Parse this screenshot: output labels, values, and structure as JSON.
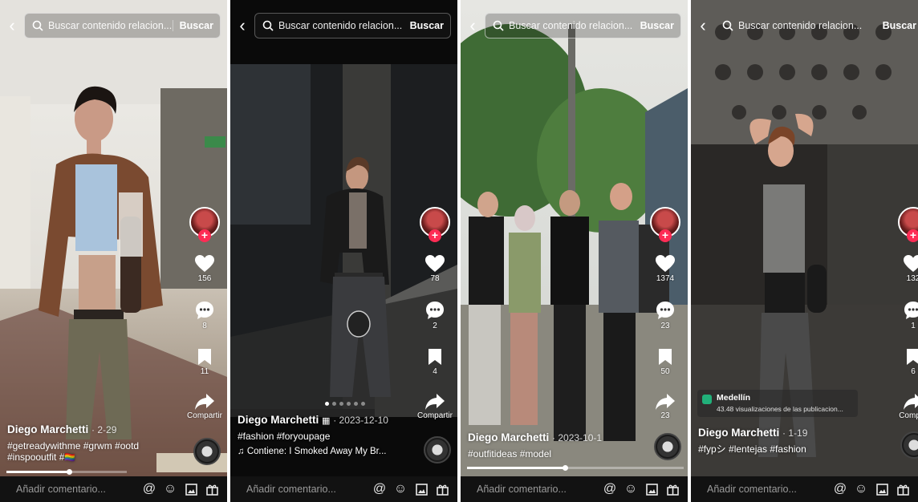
{
  "search": {
    "placeholder_text": "Buscar contenido relacion...",
    "button": "Buscar"
  },
  "bottom_bar": {
    "comment_placeholder": "Añadir comentario..."
  },
  "rail_share_label": "Compartir",
  "posts": [
    {
      "author": "Diego Marchetti",
      "date": "· 2-29",
      "tags": "#getreadywithme #grwm #ootd #inspooutfit #",
      "tag_flag": "🏳️‍🌈",
      "likes": "156",
      "comments": "8",
      "saves": "11",
      "share": "Compartir",
      "progress": 0.52
    },
    {
      "author": "Diego Marchetti",
      "date": "· 2023-12-10",
      "tags": "#fashion #foryoupage",
      "music": "♫ Contiene: I Smoked Away My Br...",
      "likes": "78",
      "comments": "2",
      "saves": "4",
      "share": "Compartir"
    },
    {
      "author": "Diego Marchetti",
      "date": "· 2023-10-1",
      "tags": "#outfitideas #model",
      "likes": "1374",
      "comments": "23",
      "saves": "50",
      "share": "23",
      "progress": 0.45
    },
    {
      "author": "Diego Marchetti",
      "date": "· 1-19",
      "tags": "#fypシ #lentejas #fashion",
      "location": "Medellín",
      "location_views": "43.48 visualizaciones de las publicacion...",
      "likes": "132",
      "comments": "1",
      "saves": "6",
      "share": "Compar"
    }
  ],
  "colors": {
    "bar_bg": "#121212",
    "follow_plus": "#fe2c55",
    "location_pin": "#21b07a"
  }
}
